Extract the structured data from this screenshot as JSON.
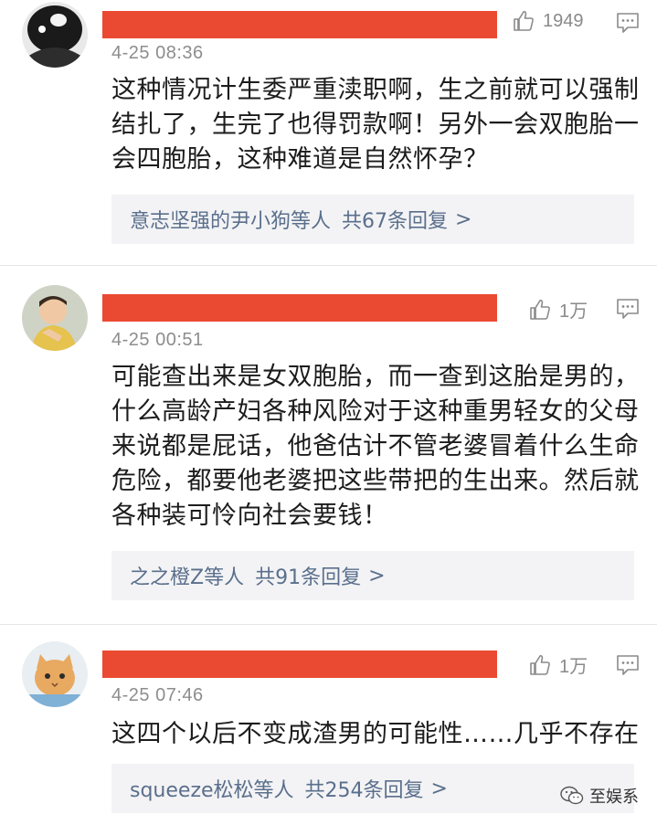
{
  "comments": [
    {
      "likes": "1949",
      "time": "4-25 08:36",
      "text": "这种情况计生委严重渎职啊，生之前就可以强制结扎了，生完了也得罚款啊！另外一会双胞胎一会四胞胎，这种难道是自然怀孕？",
      "reply_names": "意志坚强的尹小狗等人",
      "reply_count": "共67条回复",
      "reply_chevron": ">"
    },
    {
      "likes": "1万",
      "time": "4-25 00:51",
      "text": "可能查出来是女双胞胎，而一查到这胎是男的，什么高龄产妇各种风险对于这种重男轻女的父母来说都是屁话，他爸估计不管老婆冒着什么生命危险，都要他老婆把这些带把的生出来。然后就各种装可怜向社会要钱！",
      "reply_names": "之之橙Z等人",
      "reply_count": "共91条回复",
      "reply_chevron": ">"
    },
    {
      "likes": "1万",
      "time": "4-25 07:46",
      "text": "这四个以后不变成渣男的可能性……几乎不存在",
      "reply_names": "squeeze松松等人",
      "reply_count": "共254条回复",
      "reply_chevron": ">"
    }
  ],
  "watermark": {
    "label": "至娱系",
    "icon": "wechat-icon"
  },
  "colors": {
    "redaction": "#eb4a32",
    "reply_link": "#5a6f8c",
    "muted": "#8d8d8d",
    "reply_bg": "#f3f3f5"
  }
}
